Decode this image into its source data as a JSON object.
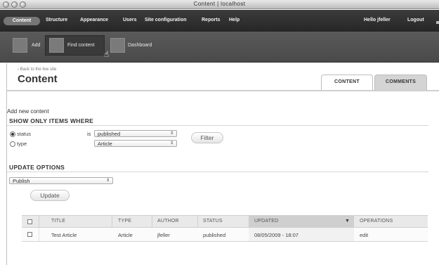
{
  "window": {
    "title": "Content | localhost"
  },
  "toolbar": {
    "items": [
      "Content",
      "Structure",
      "Appearance",
      "Users",
      "Site configuration",
      "Reports",
      "Help"
    ],
    "greeting": "Hello jfeller",
    "logout": "Logout"
  },
  "shortcuts": {
    "items": [
      "Add",
      "Find content",
      "Dashboard"
    ]
  },
  "page": {
    "back_link": "‹ Back to the live site",
    "title": "Content",
    "tabs": [
      "CONTENT",
      "COMMENTS"
    ]
  },
  "filter": {
    "add_new": "Add new content",
    "heading": "SHOW ONLY ITEMS WHERE",
    "rows": [
      {
        "field": "status",
        "op": "is",
        "value": "published",
        "selected": true
      },
      {
        "field": "type",
        "op": "",
        "value": "Article",
        "selected": false
      }
    ],
    "button": "Filter"
  },
  "update": {
    "heading": "UPDATE OPTIONS",
    "action": "Publish",
    "button": "Update"
  },
  "table": {
    "headers": [
      "TITLE",
      "TYPE",
      "AUTHOR",
      "STATUS",
      "UPDATED",
      "OPERATIONS"
    ],
    "rows": [
      [
        "Test Article",
        "Article",
        "jfeller",
        "published",
        "08/05/2009 - 18:07",
        "edit"
      ]
    ]
  }
}
